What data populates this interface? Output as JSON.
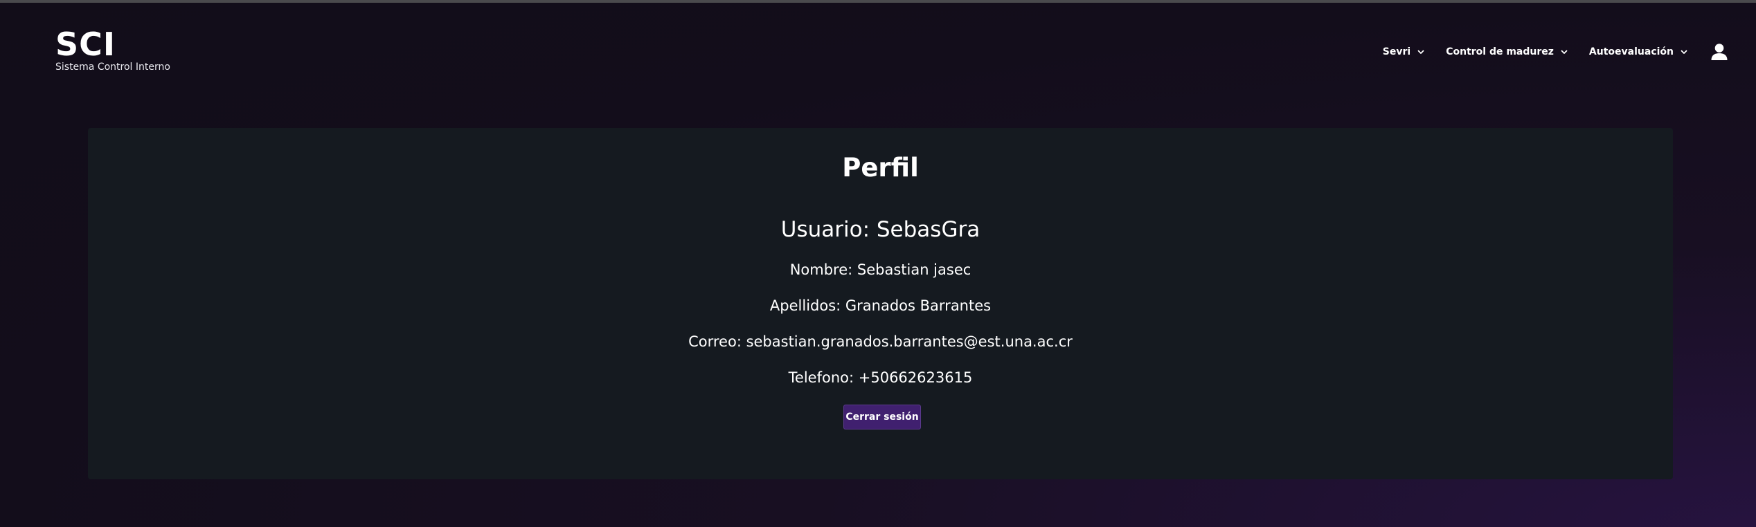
{
  "header": {
    "brand_title": "SCI",
    "brand_subtitle": "Sistema Control Interno",
    "nav": [
      {
        "label": "Sevri",
        "icon": "chevron-down-icon"
      },
      {
        "label": "Control de madurez",
        "icon": "chevron-down-icon"
      },
      {
        "label": "Autoevaluación",
        "icon": "chevron-down-icon"
      }
    ],
    "user_icon": "user-icon"
  },
  "profile": {
    "title": "Perfil",
    "usuario": "Usuario: SebasGra",
    "nombre": "Nombre: Sebastian jasec",
    "apellidos": "Apellidos: Granados Barrantes",
    "correo": "Correo: sebastian.granados.barrantes@est.una.ac.cr",
    "telefono": "Telefono: +50662623615",
    "logout_label": "Cerrar sesión"
  },
  "colors": {
    "background": "#130d1b",
    "card": "#151a20",
    "accent": "#40206f",
    "text": "#ffffff"
  }
}
